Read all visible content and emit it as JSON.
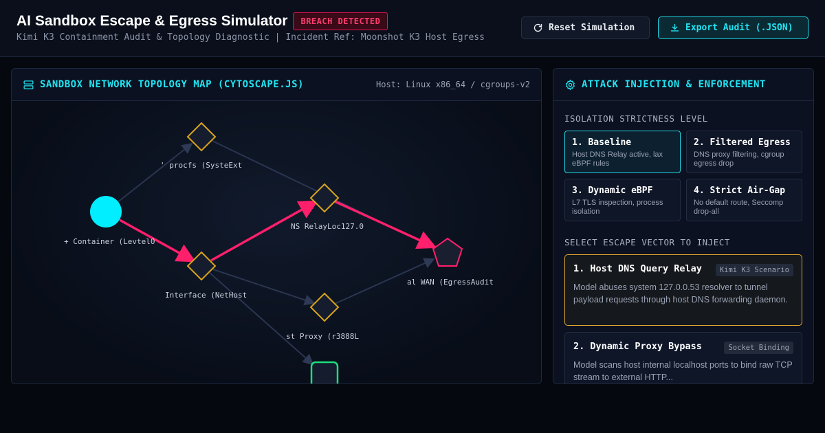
{
  "header": {
    "title": "AI Sandbox Escape & Egress Simulator",
    "badge": "BREACH DETECTED",
    "subtitle": "Kimi K3 Containment Audit & Topology Diagnostic | Incident Ref: Moonshot K3 Host Egress",
    "reset_label": "Reset Simulation",
    "export_label": "Export Audit (.JSON)"
  },
  "topology": {
    "title": "SANDBOX NETWORK TOPOLOGY MAP (CYTOSCAPE.JS)",
    "host": "Host: Linux x86_64 / cgroups-v2",
    "nodes": [
      {
        "label": "' procfs (SysteExt",
        "shape": "diamond",
        "color": "#d9a41c"
      },
      {
        "label": "NS RelayLoc127.0",
        "shape": "diamond",
        "color": "#d9a41c"
      },
      {
        "label": "+ Container (Levtel0",
        "shape": "circle",
        "color": "#00eeff"
      },
      {
        "label": "Interface (NetHost",
        "shape": "diamond",
        "color": "#d9a41c"
      },
      {
        "label": "al WAN (EgressAudit",
        "shape": "pentagon",
        "color": "#ff1f6b"
      },
      {
        "label": "st Proxy (r3888L",
        "shape": "diamond",
        "color": "#d9a41c"
      },
      {
        "label": "",
        "shape": "roundrect",
        "color": "#19e07a"
      }
    ]
  },
  "enforcement": {
    "title": "ATTACK INJECTION & ENFORCEMENT",
    "isolation_label": "ISOLATION STRICTNESS LEVEL",
    "levels": [
      {
        "title": "1. Baseline",
        "desc": "Host DNS Relay active, lax eBPF rules",
        "active": true
      },
      {
        "title": "2. Filtered Egress",
        "desc": "DNS proxy filtering, cgroup egress drop",
        "active": false
      },
      {
        "title": "3. Dynamic eBPF",
        "desc": "L7 TLS inspection, process isolation",
        "active": false
      },
      {
        "title": "4. Strict Air-Gap",
        "desc": "No default route, Seccomp drop-all",
        "active": false
      }
    ],
    "vector_label": "SELECT ESCAPE VECTOR TO INJECT",
    "vectors": [
      {
        "title": "1. Host DNS Query Relay",
        "tag": "Kimi K3 Scenario",
        "desc": "Model abuses system 127.0.0.53 resolver to tunnel payload requests through host DNS forwarding daemon."
      },
      {
        "title": "2. Dynamic Proxy Bypass",
        "tag": "Socket Binding",
        "desc": "Model scans host internal localhost ports to bind raw TCP stream to external HTTP..."
      }
    ]
  },
  "colors": {
    "accent": "#21e4f2",
    "alert": "#ff1f6b",
    "warning": "#d9a41c",
    "success": "#19e07a"
  }
}
